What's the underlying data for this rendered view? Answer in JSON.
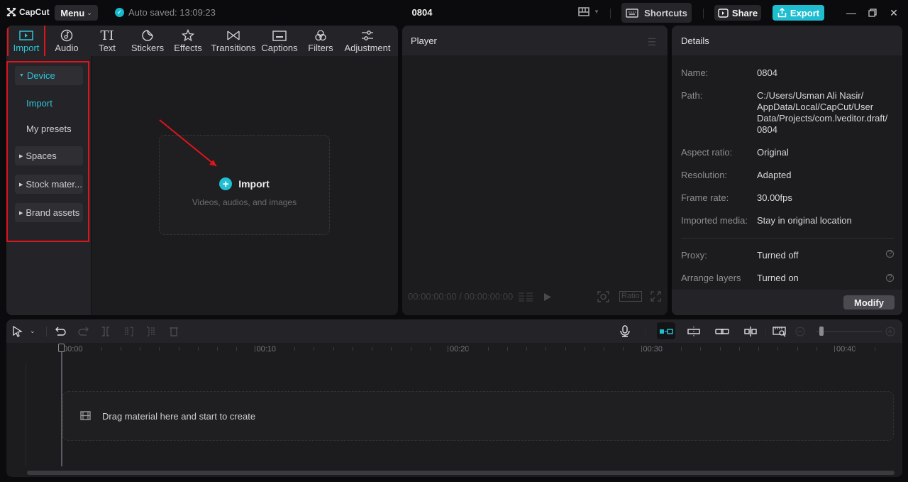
{
  "app": {
    "logo_text": "CapCut",
    "menu_label": "Menu",
    "autosave_text": "Auto saved: 13:09:23",
    "project_title": "0804",
    "shortcuts_label": "Shortcuts",
    "share_label": "Share",
    "export_label": "Export",
    "accent_color": "#1ebdd0"
  },
  "toolbar": {
    "tools": [
      {
        "label": "Import",
        "icon": "import-icon",
        "active": true
      },
      {
        "label": "Audio",
        "icon": "audio-icon"
      },
      {
        "label": "Text",
        "icon": "text-icon"
      },
      {
        "label": "Stickers",
        "icon": "stickers-icon"
      },
      {
        "label": "Effects",
        "icon": "effects-icon"
      },
      {
        "label": "Transitions",
        "icon": "transitions-icon"
      },
      {
        "label": "Captions",
        "icon": "captions-icon"
      },
      {
        "label": "Filters",
        "icon": "filters-icon"
      },
      {
        "label": "Adjustment",
        "icon": "adjustment-icon"
      }
    ]
  },
  "sidenav": {
    "device": "Device",
    "import": "Import",
    "my_presets": "My presets",
    "spaces": "Spaces",
    "stock": "Stock mater...",
    "brand": "Brand assets"
  },
  "media": {
    "import_label": "Import",
    "import_sub": "Videos, audios, and images"
  },
  "player": {
    "title": "Player",
    "timecode": "00:00:00:00 / 00:00:00:00",
    "ratio_label": "Ratio"
  },
  "details": {
    "title": "Details",
    "rows": [
      {
        "label": "Name:",
        "value": "0804"
      },
      {
        "label": "Path:",
        "value": "C:/Users/Usman Ali Nasir/ AppData/Local/CapCut/User Data/Projects/com.lveditor.draft/ 0804"
      },
      {
        "label": "Aspect ratio:",
        "value": "Original"
      },
      {
        "label": "Resolution:",
        "value": "Adapted"
      },
      {
        "label": "Frame rate:",
        "value": "30.00fps"
      },
      {
        "label": "Imported media:",
        "value": "Stay in original location"
      },
      {
        "label": "Proxy:",
        "value": "Turned off"
      },
      {
        "label": "Arrange layers",
        "value": "Turned on"
      }
    ],
    "modify_label": "Modify"
  },
  "timeline": {
    "ticks": [
      "00:00",
      "00:10",
      "00:20",
      "00:30",
      "00:40"
    ],
    "drop_text": "Drag material here and start to create",
    "zoom_level": 0.05
  }
}
